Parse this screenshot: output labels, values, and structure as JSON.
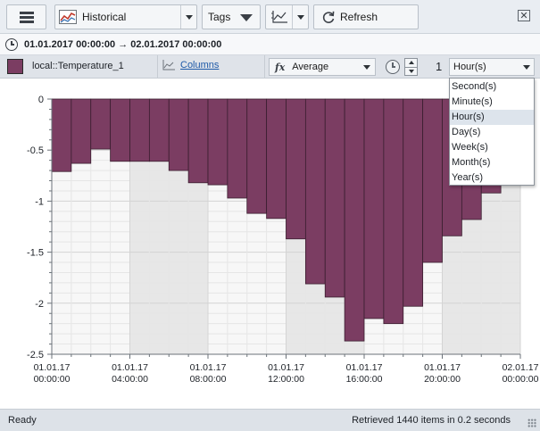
{
  "toolbar": {
    "source_label": "Historical",
    "tags_label": "Tags",
    "refresh_label": "Refresh",
    "close_glyph": "✕"
  },
  "timerange": {
    "text": "01.01.2017 00:00:00 → 02.01.2017 00:00:00"
  },
  "series": {
    "tag_name": "local::Temperature_1",
    "color": "#7b3d62",
    "columns_label": "Columns",
    "fx_symbol": "fx",
    "aggregate": "Average",
    "interval_value": "1",
    "interval_unit": "Hour(s)"
  },
  "unit_dropdown": {
    "options": [
      "Second(s)",
      "Minute(s)",
      "Hour(s)",
      "Day(s)",
      "Week(s)",
      "Month(s)",
      "Year(s)"
    ],
    "selected": "Hour(s)"
  },
  "chart_data": {
    "type": "bar",
    "bar_color": "#7b3d62",
    "bar_stroke": "#3a1e2f",
    "x_ticks": [
      [
        "01.01.17",
        "00:00:00"
      ],
      [
        "01.01.17",
        "04:00:00"
      ],
      [
        "01.01.17",
        "08:00:00"
      ],
      [
        "01.01.17",
        "12:00:00"
      ],
      [
        "01.01.17",
        "16:00:00"
      ],
      [
        "01.01.17",
        "20:00:00"
      ],
      [
        "02.01.17",
        "00:00:00"
      ]
    ],
    "y_ticks": [
      "0",
      "-0.5",
      "-1",
      "-1.5",
      "-2",
      "-2.5"
    ],
    "ylim": [
      -2.5,
      0
    ],
    "hours": 24,
    "values": [
      -0.71,
      -0.63,
      -0.49,
      -0.61,
      -0.61,
      -0.61,
      -0.7,
      -0.82,
      -0.84,
      -0.97,
      -1.12,
      -1.17,
      -1.37,
      -1.81,
      -1.94,
      -2.37,
      -2.15,
      -2.2,
      -2.03,
      -1.6,
      -1.34,
      -1.18,
      -0.92,
      -0.82
    ],
    "grid": true,
    "shaded_bands": [
      [
        4,
        8
      ],
      [
        12,
        16
      ],
      [
        20,
        24
      ]
    ]
  },
  "status": {
    "left": "Ready",
    "right": "Retrieved 1440 items in 0.2 seconds"
  }
}
